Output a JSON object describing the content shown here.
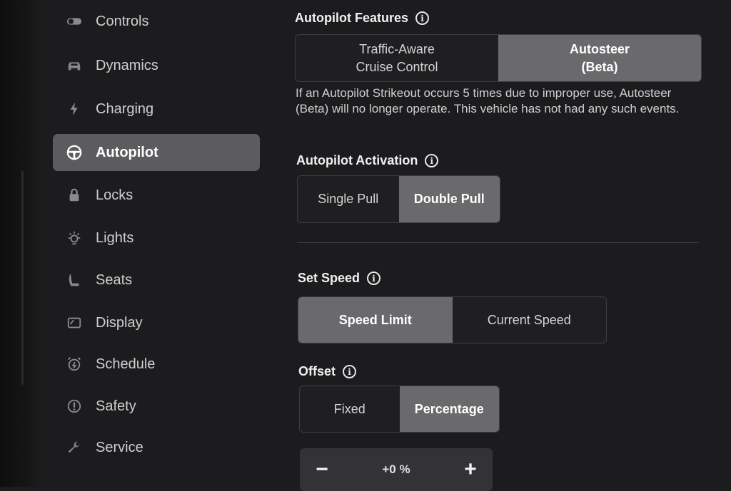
{
  "sidebar": {
    "items": [
      {
        "label": "Controls",
        "icon": "toggle-icon",
        "active": false
      },
      {
        "label": "Dynamics",
        "icon": "car-icon",
        "active": false
      },
      {
        "label": "Charging",
        "icon": "lightning-icon",
        "active": false
      },
      {
        "label": "Autopilot",
        "icon": "steering-wheel-icon",
        "active": true
      },
      {
        "label": "Locks",
        "icon": "lock-icon",
        "active": false
      },
      {
        "label": "Lights",
        "icon": "light-bulb-icon",
        "active": false
      },
      {
        "label": "Seats",
        "icon": "seat-icon",
        "active": false
      },
      {
        "label": "Display",
        "icon": "display-icon",
        "active": false
      },
      {
        "label": "Schedule",
        "icon": "alarm-clock-icon",
        "active": false
      },
      {
        "label": "Safety",
        "icon": "alert-circle-icon",
        "active": false
      },
      {
        "label": "Service",
        "icon": "wrench-icon",
        "active": false
      }
    ]
  },
  "autopilot_features": {
    "title": "Autopilot Features",
    "options": [
      "Traffic-Aware\nCruise Control",
      "Autosteer\n(Beta)"
    ],
    "selected": "Autosteer\n(Beta)",
    "description": "If an Autopilot Strikeout occurs 5 times due to improper use, Autosteer (Beta) will no longer operate. This vehicle has not had any such events."
  },
  "autopilot_activation": {
    "title": "Autopilot Activation",
    "options": [
      "Single Pull",
      "Double Pull"
    ],
    "selected": "Double Pull"
  },
  "set_speed": {
    "title": "Set Speed",
    "options": [
      "Speed Limit",
      "Current Speed"
    ],
    "selected": "Speed Limit"
  },
  "offset": {
    "title": "Offset",
    "options": [
      "Fixed",
      "Percentage"
    ],
    "selected": "Percentage",
    "value": "+0 %",
    "minus": "−",
    "plus": "+"
  },
  "colors": {
    "background": "#1c1c1e",
    "active_nav": "#5c5c5f",
    "selected_segment": "#6a6a6c"
  }
}
